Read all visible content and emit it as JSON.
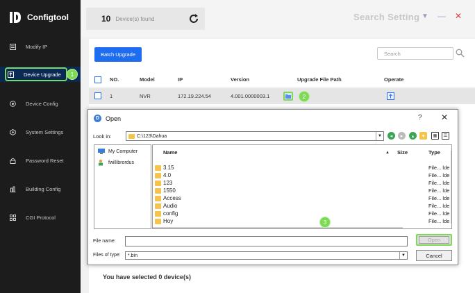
{
  "app": {
    "title": "Configtool"
  },
  "sidebar": {
    "items": [
      {
        "label": "Modify IP",
        "icon": "modify-ip-icon"
      },
      {
        "label": "Device Upgrade",
        "icon": "upgrade-icon",
        "active": true
      },
      {
        "label": "Device Config",
        "icon": "device-config-icon"
      },
      {
        "label": "System Settings",
        "icon": "system-settings-icon"
      },
      {
        "label": "Password Reset",
        "icon": "lock-icon"
      },
      {
        "label": "Building Config",
        "icon": "building-icon"
      },
      {
        "label": "CGI Protocol",
        "icon": "grid-icon"
      }
    ]
  },
  "header": {
    "device_count": "10",
    "device_found_label": "Device(s) found",
    "search_setting": "Search Setting"
  },
  "toolbar": {
    "batch_upgrade_label": "Batch Upgrade",
    "search_placeholder": "Search"
  },
  "table": {
    "columns": [
      "NO.",
      "Model",
      "IP",
      "Version",
      "Upgrade File Path",
      "Operate"
    ],
    "rows": [
      {
        "no": "1",
        "model": "NVR",
        "ip": "172.19.224.54",
        "version": "4.001.0000003.1"
      }
    ]
  },
  "footer": {
    "selected_prefix": "You have selected",
    "selected_count": "0",
    "selected_suffix": "device(s)"
  },
  "dialog": {
    "title": "Open",
    "help": "?",
    "close": "✕",
    "look_in_label": "Look in:",
    "look_in_value": "C:\\123\\Dahua",
    "places": [
      "My Computer",
      "fwillibrordus"
    ],
    "columns": {
      "name": "Name",
      "size": "Size",
      "type": "Type"
    },
    "files": [
      {
        "name": "3.15",
        "type": "File... lde"
      },
      {
        "name": "4.0",
        "type": "File... lde"
      },
      {
        "name": "123",
        "type": "File... lde"
      },
      {
        "name": "1550",
        "type": "File... lde"
      },
      {
        "name": "Access",
        "type": "File... lde"
      },
      {
        "name": "Audio",
        "type": "File... lde"
      },
      {
        "name": "config",
        "type": "File... lde"
      },
      {
        "name": "Hoy",
        "type": "File... lde"
      }
    ],
    "file_name_label": "File name:",
    "file_name_value": "",
    "file_type_label": "Files of type:",
    "file_type_value": "*.bin",
    "open_label": "Open",
    "cancel_label": "Cancel"
  },
  "annotations": {
    "step1": "1",
    "step2": "2",
    "step3": "3"
  },
  "colors": {
    "accent": "#1e6cf0",
    "highlight": "#7ed957",
    "sidebar_bg": "#1c1c1c",
    "close": "#e03a3a"
  }
}
